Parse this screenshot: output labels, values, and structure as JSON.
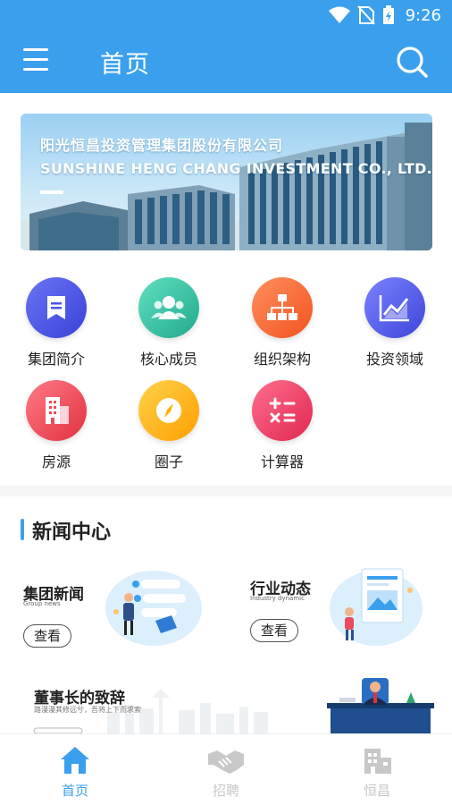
{
  "status": {
    "time": "9:26"
  },
  "appbar": {
    "title": "首页"
  },
  "banner": {
    "company_cn": "阳光恒昌投资管理集团股份有限公司",
    "company_en": "SUNSHINE HENG CHANG INVESTMENT CO., LTD."
  },
  "grid": [
    {
      "label": "集团简介",
      "icon": "bookmark-icon",
      "color": "#4a56e8"
    },
    {
      "label": "核心成员",
      "icon": "people-icon",
      "color": "#37c4a4"
    },
    {
      "label": "组织架构",
      "icon": "org-chart-icon",
      "color": "#ff6b3d"
    },
    {
      "label": "投资领域",
      "icon": "chart-icon",
      "color": "#5b5ff0"
    },
    {
      "label": "房源",
      "icon": "building-icon",
      "color": "#ef4a57"
    },
    {
      "label": "圈子",
      "icon": "compass-icon",
      "color": "#ffb300"
    },
    {
      "label": "计算器",
      "icon": "calculator-icon",
      "color": "#f2406a"
    }
  ],
  "news_section": {
    "title": "新闻中心",
    "cards": [
      {
        "title": "集团新闻",
        "subtitle": "Group news",
        "button": "查看"
      },
      {
        "title": "行业动态",
        "subtitle": "Industry dynamic",
        "button": "查看"
      }
    ],
    "chairman": {
      "title": "董事长的致辞",
      "subtitle": "路漫漫其修远兮，吾将上下而求索"
    }
  },
  "tabs": [
    {
      "label": "首页",
      "icon": "home-icon",
      "active": true
    },
    {
      "label": "招聘",
      "icon": "handshake-icon",
      "active": false
    },
    {
      "label": "恒昌",
      "icon": "building-icon",
      "active": false
    }
  ],
  "colors": {
    "primary": "#3aa0ee",
    "inactive": "#c8c8c8"
  }
}
